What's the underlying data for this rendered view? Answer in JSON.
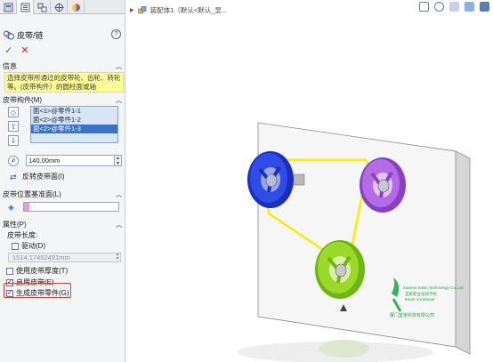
{
  "tabs": [
    {
      "icon": "feature-manager-icon"
    },
    {
      "icon": "property-manager-icon"
    },
    {
      "icon": "configuration-manager-icon"
    },
    {
      "icon": "dim-xpert-icon"
    },
    {
      "icon": "display-manager-icon"
    }
  ],
  "header": {
    "title": "皮带/链",
    "help": "?"
  },
  "actions": {
    "ok": "✓",
    "cancel": "✕"
  },
  "message": {
    "title": "信息",
    "text": "选择皮带所通过的皮带轮、齿轮、转轮等。(皮带构件）的圆柱面或轴"
  },
  "components": {
    "title": "皮带构件(M)",
    "items": [
      "面<1>@零件1-1",
      "面<2>@零件1-2",
      "面<2>@零件1-3"
    ],
    "selected_index": 2
  },
  "length": {
    "value": "140.00mm"
  },
  "reverse": {
    "label": "反转皮带面(I)"
  },
  "plane": {
    "title": "皮带位置基准面(L)"
  },
  "properties": {
    "title": "属性(P)",
    "belt_length_label": "皮带长度:",
    "driving_label": "驱动(D)",
    "driving_checked": false,
    "belt_length_value": "1514.17452491mm",
    "use_thickness_label": "使用皮带厚度(T)",
    "use_thickness_checked": false,
    "enable_belt_label": "启用皮带(E)",
    "enable_belt_checked": true,
    "create_part_label": "生成皮带零件(G)",
    "create_part_checked": true
  },
  "viewport": {
    "breadcrumb": "装配体1（默认<默认_显...",
    "logo_text_cn": "厦门宜家科技有限公司",
    "logo_text_en": "Xiamen Easin Technology Co.,Ltd.",
    "logo_text_cn2": "宜家职业培训学校",
    "logo_text_en2": "Easin Vocational"
  },
  "colors": {
    "accent": "#3b73c4",
    "belt": "#f2ee2a",
    "pulley_blue": "#1f3ad6",
    "pulley_purple": "#a45ad6",
    "pulley_green": "#8bd21d",
    "plate": "#f7f7f7",
    "highlight": "#e23b3b"
  }
}
